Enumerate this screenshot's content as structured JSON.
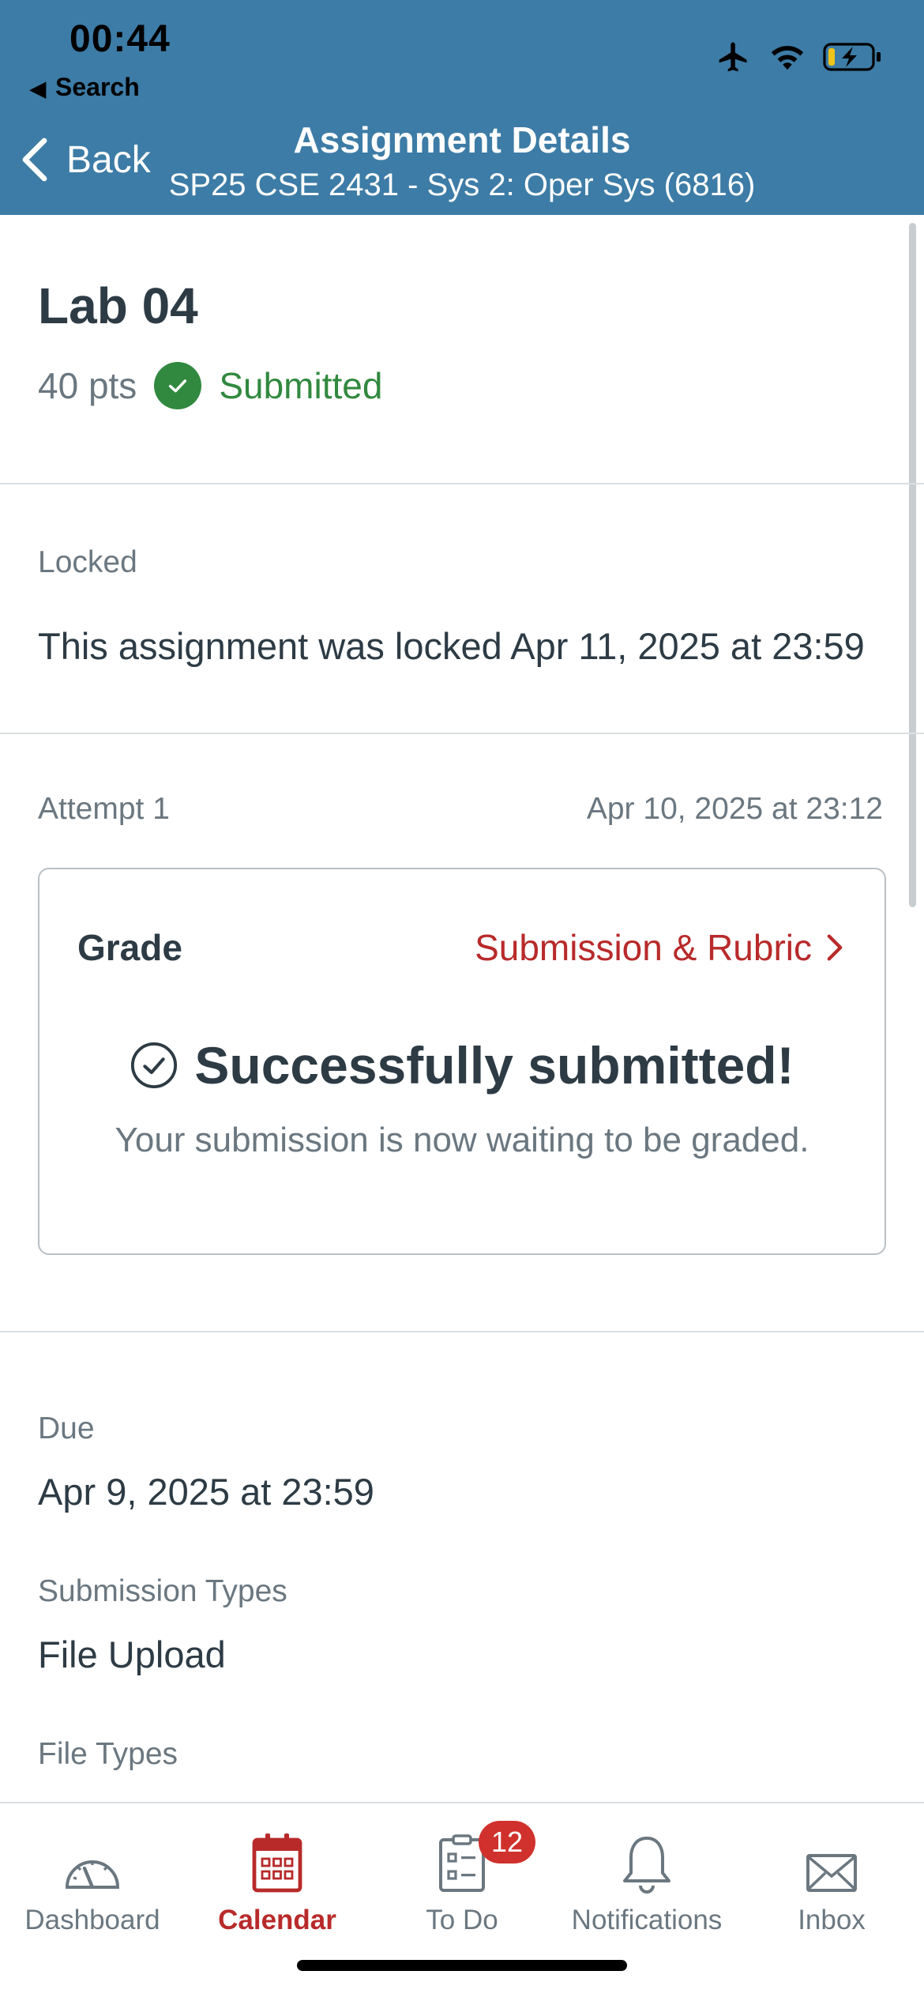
{
  "status_bar": {
    "time": "00:44",
    "back_app": "Search",
    "icons": [
      "airplane-icon",
      "wifi-icon",
      "battery-charging-icon"
    ]
  },
  "nav": {
    "back_label": "Back",
    "title": "Assignment Details",
    "subtitle": "SP25 CSE 2431 - Sys 2: Oper Sys (6816)",
    "color": "#3d7ca6"
  },
  "assignment": {
    "title": "Lab 04",
    "points": "40 pts",
    "status": "Submitted",
    "status_color": "#31893f"
  },
  "lock": {
    "label": "Locked",
    "message": "This assignment was locked Apr 11, 2025 at 23:59"
  },
  "attempt": {
    "label": "Attempt 1",
    "date": "Apr 10, 2025 at 23:12"
  },
  "grade_card": {
    "label": "Grade",
    "link": "Submission & Rubric",
    "success_title": "Successfully submitted!",
    "success_subtitle": "Your submission is now waiting to be graded."
  },
  "details": {
    "due_label": "Due",
    "due_value": "Apr 9, 2025 at 23:59",
    "submission_types_label": "Submission Types",
    "submission_types_value": "File Upload",
    "file_types_label": "File Types"
  },
  "tabbar": {
    "accent": "#b82a2a",
    "items": [
      {
        "label": "Dashboard",
        "icon": "dashboard-icon"
      },
      {
        "label": "Calendar",
        "icon": "calendar-icon",
        "active": true
      },
      {
        "label": "To Do",
        "icon": "todo-icon",
        "badge": "12"
      },
      {
        "label": "Notifications",
        "icon": "bell-icon"
      },
      {
        "label": "Inbox",
        "icon": "envelope-icon"
      }
    ]
  }
}
